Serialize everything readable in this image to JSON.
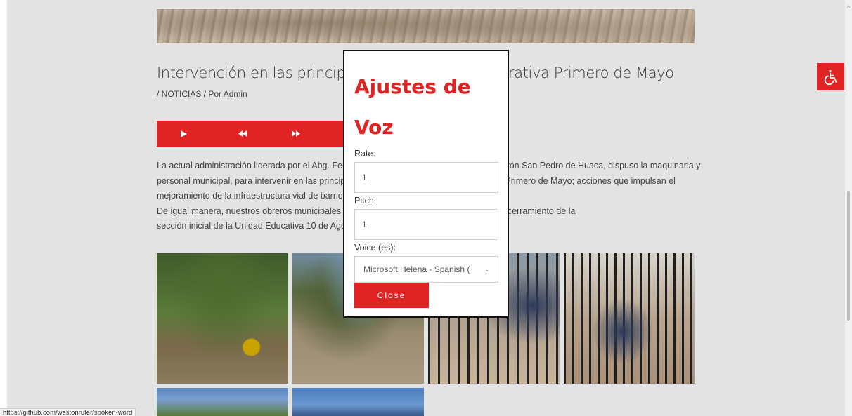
{
  "post": {
    "title": "Intervención en las principales calles de la Cooperativa Primero de Mayo",
    "meta": "/ NOTICIAS / Por Admin",
    "paragraphs": [
      "La actual administración liderada por el Abg. Fernando Eduardo Calderón, alcalde del cantón San Pedro de Huaca, dispuso la maquinaria y",
      "personal municipal, para intervenir en las principales calles de la cooperativa de vivienda Primero de Mayo; acciones que impulsan el",
      "mejoramiento de la infraestructura vial de barrios y comunidades.",
      "De igual manera, nuestros obreros municipales trabajan en la colocación de cerámica del cerramiento de la",
      "sección inicial de la Unidad Educativa 10 de Agosto."
    ]
  },
  "player": {
    "play_icon": "play-icon",
    "rewind_icon": "rewind-icon",
    "forward_icon": "fast-forward-icon"
  },
  "modal": {
    "title": "Ajustes de Voz",
    "rate_label": "Rate:",
    "rate_value": "1",
    "pitch_label": "Pitch:",
    "pitch_value": "1",
    "voice_label": "Voice (es):",
    "voice_selected": "Microsoft Helena - Spanish (",
    "close_label": "Close"
  },
  "status_bar": {
    "url": "https://github.com/westonruter/spoken-word"
  },
  "accessibility": {
    "icon": "wheelchair-icon"
  },
  "colors": {
    "accent": "#e02424",
    "page_background": "#e3e3e3",
    "modal_border": "#111111"
  }
}
